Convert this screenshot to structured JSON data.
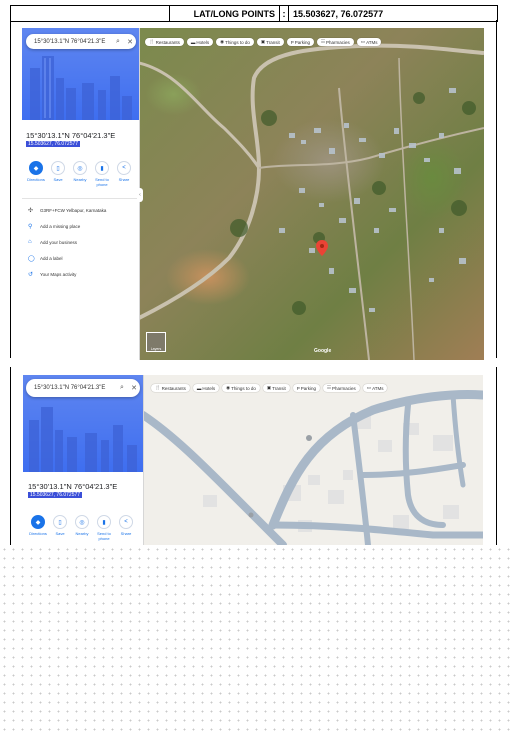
{
  "header": {
    "label": "LAT/LONG POINTS",
    "separator": ":",
    "value": "15.503627, 76.072577"
  },
  "screenshot1": {
    "search_query": "15°30'13.1\"N 76°04'21.3\"E",
    "place_title": "15°30'13.1\"N 76°04'21.3\"E",
    "place_subtitle": "15.503627, 76.072577",
    "actions": [
      {
        "label": "Directions",
        "icon": "directions-icon"
      },
      {
        "label": "Save",
        "icon": "bookmark-icon"
      },
      {
        "label": "Nearby",
        "icon": "nearby-icon"
      },
      {
        "label": "Send to phone",
        "icon": "phone-icon"
      },
      {
        "label": "Share",
        "icon": "share-icon"
      }
    ],
    "list_items": [
      {
        "text": "G3RF+FCW Yelbapur, Karnataka",
        "icon": "plus-code-icon"
      },
      {
        "text": "Add a missing place",
        "icon": "pin-icon"
      },
      {
        "text": "Add your business",
        "icon": "store-icon"
      },
      {
        "text": "Add a label",
        "icon": "label-icon"
      },
      {
        "text": "Your Maps activity",
        "icon": "history-icon"
      }
    ],
    "chips": [
      {
        "label": "Restaurants",
        "icon": "fork-knife-icon"
      },
      {
        "label": "Hotels",
        "icon": "bed-icon"
      },
      {
        "label": "Things to do",
        "icon": "camera-icon"
      },
      {
        "label": "Transit",
        "icon": "bus-icon"
      },
      {
        "label": "Parking",
        "icon": "parking-icon"
      },
      {
        "label": "Pharmacies",
        "icon": "pharmacy-icon"
      },
      {
        "label": "ATMs",
        "icon": "atm-icon"
      }
    ],
    "layers_label": "Layers"
  },
  "screenshot2": {
    "search_query": "15°30'13.1\"N 76°04'21.3\"E",
    "place_title": "15°30'13.1\"N 76°04'21.3\"E",
    "place_subtitle": "15.503627, 76.072577",
    "actions": [
      {
        "label": "Directions",
        "icon": "directions-icon"
      },
      {
        "label": "Save",
        "icon": "bookmark-icon"
      },
      {
        "label": "Nearby",
        "icon": "nearby-icon"
      },
      {
        "label": "Send to phone",
        "icon": "phone-icon"
      },
      {
        "label": "Share",
        "icon": "share-icon"
      }
    ],
    "chips": [
      {
        "label": "Restaurants",
        "icon": "fork-knife-icon"
      },
      {
        "label": "Hotels",
        "icon": "bed-icon"
      },
      {
        "label": "Things to do",
        "icon": "camera-icon"
      },
      {
        "label": "Transit",
        "icon": "bus-icon"
      },
      {
        "label": "Parking",
        "icon": "parking-icon"
      },
      {
        "label": "Pharmacies",
        "icon": "pharmacy-icon"
      },
      {
        "label": "ATMs",
        "icon": "atm-icon"
      }
    ]
  },
  "colors": {
    "accent": "#1a73e8",
    "hero": "#4a78f0",
    "pin": "#ea4335",
    "road": "#a9b8c8"
  }
}
